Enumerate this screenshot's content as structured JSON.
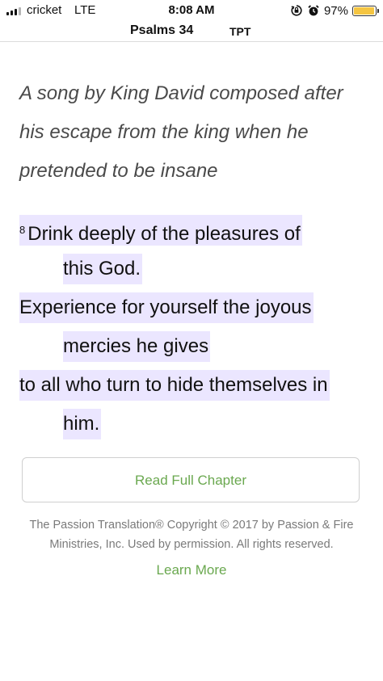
{
  "status_bar": {
    "carrier": "cricket",
    "network": "LTE",
    "time": "8:08 AM",
    "battery_percent": "97%",
    "battery_level": 0.97,
    "battery_color": "#f5c542",
    "icons": [
      "signal-icon",
      "rotation-lock-icon",
      "alarm-icon",
      "battery-icon"
    ]
  },
  "header": {
    "book_chapter": "Psalms 34",
    "version": "TPT"
  },
  "passage": {
    "heading": "A song by King David composed after his escape from the king when he pretended to be insane",
    "verse_number": "8",
    "lines": [
      "Drink deeply of the pleasures of",
      "this God.",
      "Experience for yourself the joyous",
      "mercies he gives",
      "to all who turn to hide themselves in",
      "him."
    ],
    "highlight_color": "#ebe6ff"
  },
  "actions": {
    "read_full_chapter": "Read Full Chapter",
    "learn_more": "Learn More",
    "accent_color": "#6aa84f"
  },
  "copyright": "The Passion Translation® Copyright © 2017 by Passion & Fire Ministries, Inc. Used by permission. All rights reserved."
}
